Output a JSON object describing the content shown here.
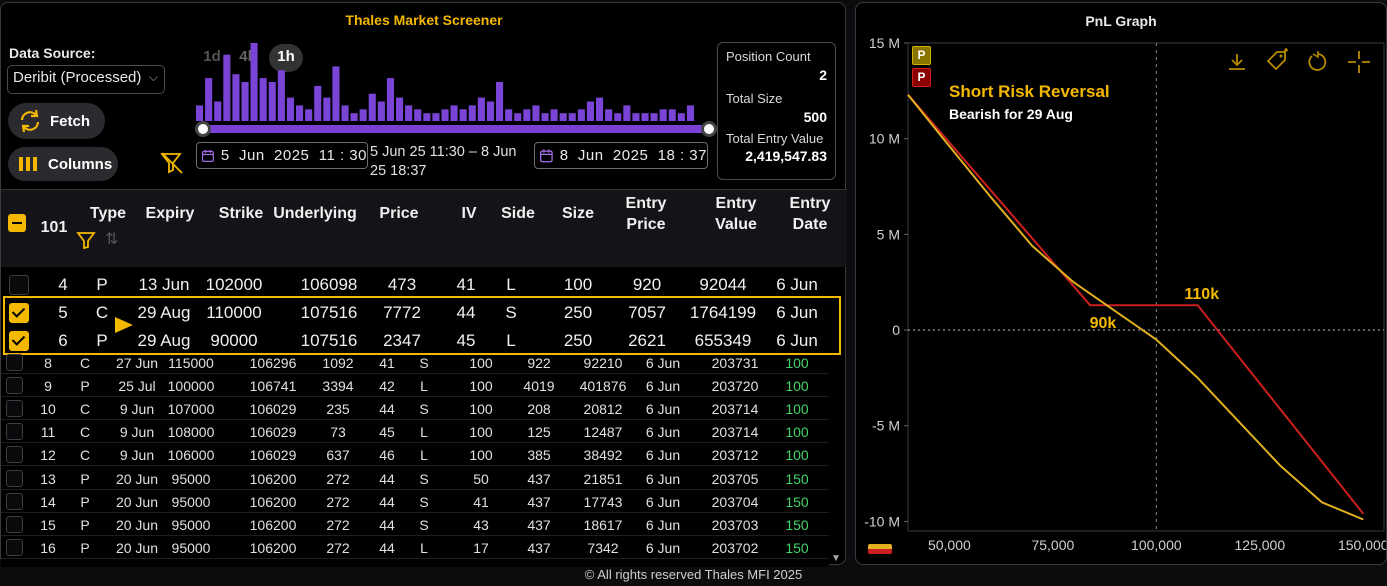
{
  "screener": {
    "title": "Thales Market Screener",
    "data_source_label": "Data Source:",
    "data_source_value": "Deribit (Processed)",
    "fetch_label": "Fetch",
    "columns_label": "Columns",
    "intervals": [
      "1d",
      "4h",
      "1h"
    ],
    "selected_interval": "1h",
    "start_date": "5  Jun  2025  11 : 30",
    "end_date": "8  Jun  2025  18 : 37",
    "range_text": "5 Jun 25 11:30 – 8 Jun 25 18:37",
    "histogram": [
      0.2,
      0.55,
      0.25,
      0.85,
      0.6,
      0.5,
      1.0,
      0.55,
      0.5,
      0.65,
      0.3,
      0.2,
      0.15,
      0.45,
      0.3,
      0.7,
      0.2,
      0.1,
      0.15,
      0.35,
      0.25,
      0.55,
      0.3,
      0.2,
      0.15,
      0.1,
      0.1,
      0.15,
      0.2,
      0.15,
      0.2,
      0.3,
      0.25,
      0.5,
      0.15,
      0.1,
      0.15,
      0.2,
      0.1,
      0.15,
      0.1,
      0.1,
      0.15,
      0.25,
      0.3,
      0.15,
      0.1,
      0.2,
      0.1,
      0.1,
      0.1,
      0.15,
      0.15,
      0.1,
      0.2
    ]
  },
  "stats": {
    "position_count_label": "Position Count",
    "position_count": "2",
    "total_size_label": "Total Size",
    "total_size": "500",
    "total_entry_value_label": "Total Entry Value",
    "total_entry_value": "2,419,547.83"
  },
  "table": {
    "count": "101",
    "headers": {
      "type": "Type",
      "expiry": "Expiry",
      "strike": "Strike",
      "underlying": "Underlying",
      "price": "Price",
      "iv": "IV",
      "side": "Side",
      "size": "Size",
      "entry_price_1": "Entry",
      "entry_price_2": "Price",
      "entry_value_1": "Entry",
      "entry_value_2": "Value",
      "entry_date_1": "Entry",
      "entry_date_2": "Date"
    },
    "big_rows": [
      {
        "checked": false,
        "id": "4",
        "type": "P",
        "expiry": "13 Jun",
        "strike": "102000",
        "underlying": "106098",
        "price": "473",
        "iv": "41",
        "side": "L",
        "size": "100",
        "entry_price": "920",
        "entry_value": "92044",
        "entry_date": "6 Jun"
      },
      {
        "checked": true,
        "id": "5",
        "type": "C",
        "expiry": "29 Aug",
        "strike": "110000",
        "underlying": "107516",
        "price": "7772",
        "iv": "44",
        "side": "S",
        "size": "250",
        "entry_price": "7057",
        "entry_value": "1764199",
        "entry_date": "6 Jun"
      },
      {
        "checked": true,
        "id": "6",
        "type": "P",
        "expiry": "29 Aug",
        "strike": "90000",
        "underlying": "107516",
        "price": "2347",
        "iv": "45",
        "side": "L",
        "size": "250",
        "entry_price": "2621",
        "entry_value": "655349",
        "entry_date": "6 Jun"
      }
    ],
    "small_rows": [
      {
        "id": "8",
        "type": "C",
        "expiry": "27 Jun",
        "strike": "115000",
        "underlying": "106296",
        "price": "1092",
        "iv": "41",
        "side": "S",
        "size": "100",
        "entry_price": "922",
        "entry_value": "92210",
        "entry_date": "6 Jun",
        "ref": "203731",
        "last": "100"
      },
      {
        "id": "9",
        "type": "P",
        "expiry": "25 Jul",
        "strike": "100000",
        "underlying": "106741",
        "price": "3394",
        "iv": "42",
        "side": "L",
        "size": "100",
        "entry_price": "4019",
        "entry_value": "401876",
        "entry_date": "6 Jun",
        "ref": "203720",
        "last": "100"
      },
      {
        "id": "10",
        "type": "C",
        "expiry": "9 Jun",
        "strike": "107000",
        "underlying": "106029",
        "price": "235",
        "iv": "44",
        "side": "S",
        "size": "100",
        "entry_price": "208",
        "entry_value": "20812",
        "entry_date": "6 Jun",
        "ref": "203714",
        "last": "100"
      },
      {
        "id": "11",
        "type": "C",
        "expiry": "9 Jun",
        "strike": "108000",
        "underlying": "106029",
        "price": "73",
        "iv": "45",
        "side": "L",
        "size": "100",
        "entry_price": "125",
        "entry_value": "12487",
        "entry_date": "6 Jun",
        "ref": "203714",
        "last": "100"
      },
      {
        "id": "12",
        "type": "C",
        "expiry": "9 Jun",
        "strike": "106000",
        "underlying": "106029",
        "price": "637",
        "iv": "46",
        "side": "L",
        "size": "100",
        "entry_price": "385",
        "entry_value": "38492",
        "entry_date": "6 Jun",
        "ref": "203712",
        "last": "100"
      },
      {
        "id": "13",
        "type": "P",
        "expiry": "20 Jun",
        "strike": "95000",
        "underlying": "106200",
        "price": "272",
        "iv": "44",
        "side": "S",
        "size": "50",
        "entry_price": "437",
        "entry_value": "21851",
        "entry_date": "6 Jun",
        "ref": "203705",
        "last": "150"
      },
      {
        "id": "14",
        "type": "P",
        "expiry": "20 Jun",
        "strike": "95000",
        "underlying": "106200",
        "price": "272",
        "iv": "44",
        "side": "S",
        "size": "41",
        "entry_price": "437",
        "entry_value": "17743",
        "entry_date": "6 Jun",
        "ref": "203704",
        "last": "150"
      },
      {
        "id": "15",
        "type": "P",
        "expiry": "20 Jun",
        "strike": "95000",
        "underlying": "106200",
        "price": "272",
        "iv": "44",
        "side": "S",
        "size": "43",
        "entry_price": "437",
        "entry_value": "18617",
        "entry_date": "6 Jun",
        "ref": "203703",
        "last": "150"
      },
      {
        "id": "16",
        "type": "P",
        "expiry": "20 Jun",
        "strike": "95000",
        "underlying": "106200",
        "price": "272",
        "iv": "44",
        "side": "L",
        "size": "17",
        "entry_price": "437",
        "entry_value": "7342",
        "entry_date": "6 Jun",
        "ref": "203702",
        "last": "150"
      }
    ]
  },
  "pnl": {
    "title": "PnL Graph",
    "strategy_title": "Short Risk Reversal",
    "strategy_subtitle": "Bearish for 29 Aug",
    "strike_low_label": "90k",
    "strike_high_label": "110k",
    "legend_badges": [
      "P",
      "P"
    ]
  },
  "chart_data": {
    "type": "line",
    "title": "PnL Graph",
    "xlabel": "",
    "ylabel": "",
    "xlim": [
      40000,
      155000
    ],
    "ylim": [
      -10500000,
      15000000
    ],
    "x_ticks": [
      50000,
      75000,
      100000,
      125000,
      150000
    ],
    "x_tick_labels": [
      "50,000",
      "75,000",
      "100,000",
      "125,000",
      "150,000"
    ],
    "y_ticks": [
      15000000,
      10000000,
      5000000,
      0,
      -5000000,
      -10000000
    ],
    "y_tick_labels": [
      "15 M",
      "10 M",
      "5 M",
      "0",
      "-5 M",
      "-10 M"
    ],
    "grid": false,
    "series": [
      {
        "color": "#cc1f1f",
        "x": [
          40000,
          84000,
          90000,
          110000,
          150000
        ],
        "y": [
          12300000,
          1300000,
          1300000,
          1300000,
          -9600000
        ]
      },
      {
        "color": "#e0b020",
        "x": [
          40000,
          50000,
          60000,
          70000,
          80000,
          90000,
          100000,
          110000,
          120000,
          130000,
          140000,
          150000
        ],
        "y": [
          12300000,
          9600000,
          6950000,
          4400000,
          2500000,
          1000000,
          -500000,
          -2500000,
          -4800000,
          -7100000,
          -9000000,
          -9900000
        ]
      }
    ],
    "annotations": [
      {
        "text": "90k",
        "x": 90000
      },
      {
        "text": "110k",
        "x": 110000
      }
    ]
  },
  "footer": {
    "copyright": "© All rights reserved Thales MFI 2025"
  }
}
